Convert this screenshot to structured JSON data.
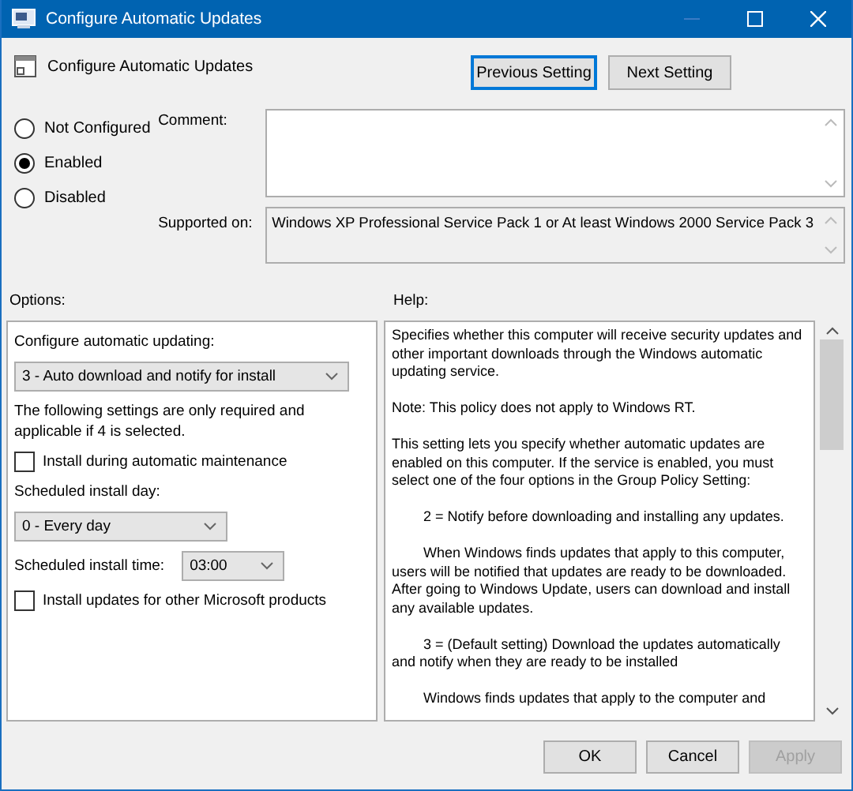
{
  "window": {
    "title": "Configure Automatic Updates"
  },
  "header": {
    "title": "Configure Automatic Updates"
  },
  "nav_buttons": [
    {
      "label": "Previous Setting",
      "focused": true
    },
    {
      "label": "Next Setting",
      "focused": false
    }
  ],
  "state_options": [
    {
      "label": "Not Configured",
      "selected": false
    },
    {
      "label": "Enabled",
      "selected": true
    },
    {
      "label": "Disabled",
      "selected": false
    }
  ],
  "comment": {
    "label": "Comment:"
  },
  "supported_on": {
    "label": "Supported on:",
    "value": "Windows XP Professional Service Pack 1 or At least Windows 2000 Service Pack 3"
  },
  "options": {
    "label": "Options:",
    "items": [
      {
        "kind": "label",
        "text": "Configure automatic updating:"
      },
      {
        "kind": "dropdown",
        "value": "3 - Auto download and notify for install"
      },
      {
        "kind": "label",
        "text": "The following settings are only required and applicable if 4 is selected."
      },
      {
        "kind": "checkbox",
        "text": "Install during automatic maintenance",
        "checked": false
      },
      {
        "kind": "label",
        "text": "Scheduled install day:"
      },
      {
        "kind": "dropdown",
        "value": "0 - Every day"
      },
      {
        "kind": "labeled_dropdown",
        "text": "Scheduled install time:",
        "value": "03:00"
      },
      {
        "kind": "checkbox",
        "text": "Install updates for other Microsoft products",
        "checked": false
      }
    ]
  },
  "help": {
    "label": "Help:",
    "paragraphs": [
      {
        "text": "Specifies whether this computer will receive security updates and other important downloads through the Windows automatic updating service.",
        "indented": false
      },
      {
        "text": "Note: This policy does not apply to Windows RT.",
        "indented": false
      },
      {
        "text": "This setting lets you specify whether automatic updates are enabled on this computer. If the service is enabled, you must select one of the four options in the Group Policy Setting:",
        "indented": false
      },
      {
        "text": "2 = Notify before downloading and installing any updates.",
        "indented": true
      },
      {
        "text": "When Windows finds updates that apply to this computer, users will be notified that updates are ready to be downloaded. After going to Windows Update, users can download and install any available updates.",
        "indented": true
      },
      {
        "text": "3 = (Default setting) Download the updates automatically and notify when they are ready to be installed",
        "indented": true
      },
      {
        "text": "Windows finds updates that apply to the computer and",
        "indented": true
      }
    ]
  },
  "buttons": [
    {
      "label": "OK",
      "disabled": false
    },
    {
      "label": "Cancel",
      "disabled": false
    },
    {
      "label": "Apply",
      "disabled": true
    }
  ]
}
